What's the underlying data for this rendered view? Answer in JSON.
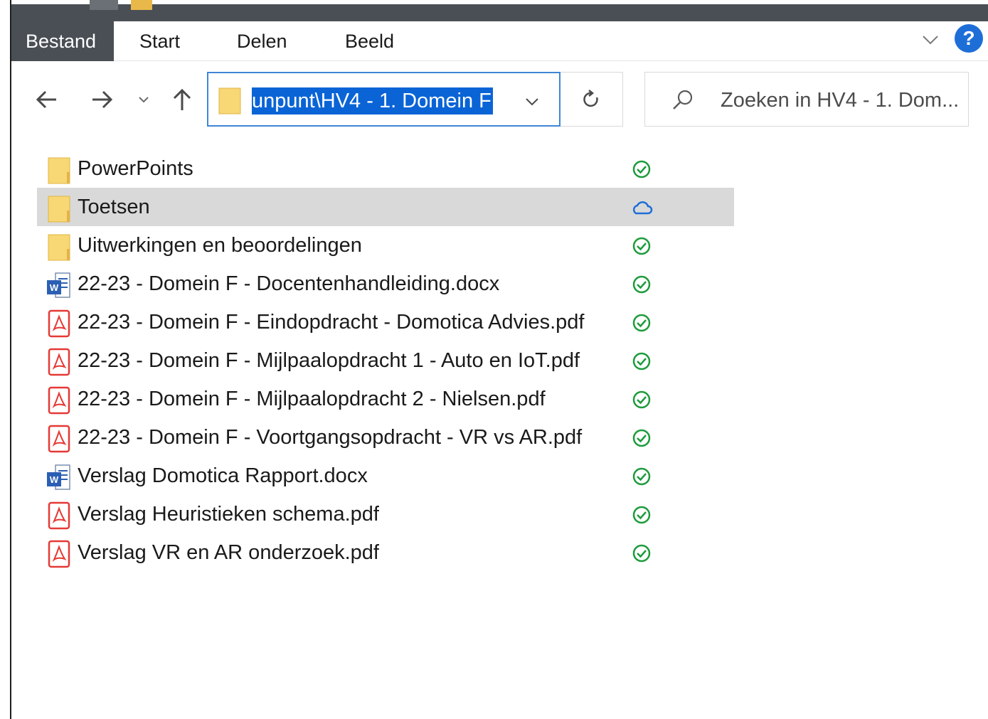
{
  "ribbon": {
    "tabs": [
      "Bestand",
      "Start",
      "Delen",
      "Beeld"
    ]
  },
  "address": {
    "path": "unpunt\\HV4 - 1. Domein F"
  },
  "search": {
    "placeholder": "Zoeken in HV4 - 1. Dom..."
  },
  "colors": {
    "accent": "#0a64d6",
    "file_tab": "#4a4f55",
    "sync_ok": "#1e9b3c",
    "sync_cloud": "#1e6ed8",
    "pdf": "#e53935",
    "word": "#2b5fb4",
    "folder": "#f8d775"
  },
  "files": [
    {
      "name": "PowerPoints",
      "type": "folder",
      "status": "synced"
    },
    {
      "name": "Toetsen",
      "type": "folder",
      "status": "cloud",
      "selected": true
    },
    {
      "name": "Uitwerkingen en beoordelingen",
      "type": "folder",
      "status": "synced"
    },
    {
      "name": "22-23 - Domein F - Docentenhandleiding.docx",
      "type": "word",
      "status": "synced"
    },
    {
      "name": "22-23 - Domein F - Eindopdracht - Domotica Advies.pdf",
      "type": "pdf",
      "status": "synced"
    },
    {
      "name": "22-23 - Domein F - Mijlpaalopdracht 1 - Auto en IoT.pdf",
      "type": "pdf",
      "status": "synced"
    },
    {
      "name": "22-23 - Domein F - Mijlpaalopdracht 2 -  Nielsen.pdf",
      "type": "pdf",
      "status": "synced"
    },
    {
      "name": "22-23 - Domein F - Voortgangsopdracht - VR vs AR.pdf",
      "type": "pdf",
      "status": "synced"
    },
    {
      "name": "Verslag Domotica Rapport.docx",
      "type": "word",
      "status": "synced"
    },
    {
      "name": "Verslag Heuristieken schema.pdf",
      "type": "pdf",
      "status": "synced"
    },
    {
      "name": "Verslag VR en AR onderzoek.pdf",
      "type": "pdf",
      "status": "synced"
    }
  ]
}
